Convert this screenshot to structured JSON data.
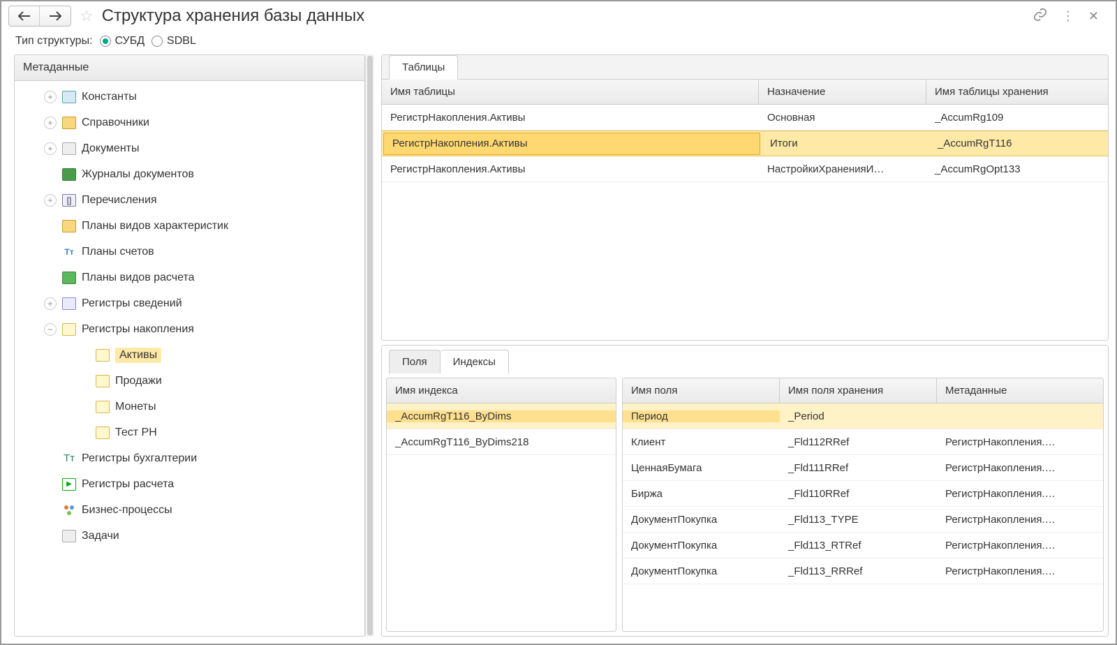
{
  "titlebar": {
    "title": "Структура хранения базы данных"
  },
  "structure_type": {
    "label": "Тип структуры:",
    "opt1": "СУБД",
    "opt2": "SDBL"
  },
  "tree": {
    "header": "Метаданные",
    "items": [
      {
        "label": "Константы",
        "icon": "const",
        "exp": "plus",
        "lvl": 0
      },
      {
        "label": "Справочники",
        "icon": "catalog",
        "exp": "plus",
        "lvl": 0
      },
      {
        "label": "Документы",
        "icon": "doc",
        "exp": "plus",
        "lvl": 0
      },
      {
        "label": "Журналы документов",
        "icon": "journal",
        "exp": "",
        "lvl": 0
      },
      {
        "label": "Перечисления",
        "icon": "enum",
        "exp": "plus",
        "lvl": 0
      },
      {
        "label": "Планы видов характеристик",
        "icon": "plan",
        "exp": "",
        "lvl": 0
      },
      {
        "label": "Планы счетов",
        "icon": "acct",
        "exp": "",
        "lvl": 0
      },
      {
        "label": "Планы видов расчета",
        "icon": "calc",
        "exp": "",
        "lvl": 0
      },
      {
        "label": "Регистры сведений",
        "icon": "inforeg",
        "exp": "plus",
        "lvl": 0
      },
      {
        "label": "Регистры накопления",
        "icon": "accreg",
        "exp": "minus",
        "lvl": 0
      },
      {
        "label": "Активы",
        "icon": "accreg",
        "exp": "",
        "lvl": 1,
        "sel": true
      },
      {
        "label": "Продажи",
        "icon": "accreg",
        "exp": "",
        "lvl": 1
      },
      {
        "label": "Монеты",
        "icon": "accreg",
        "exp": "",
        "lvl": 1
      },
      {
        "label": "Тест РН",
        "icon": "accreg",
        "exp": "",
        "lvl": 1
      },
      {
        "label": "Регистры бухгалтерии",
        "icon": "bookreg",
        "exp": "",
        "lvl": 0
      },
      {
        "label": "Регистры расчета",
        "icon": "calcreg",
        "exp": "",
        "lvl": 0
      },
      {
        "label": "Бизнес-процессы",
        "icon": "bp",
        "exp": "",
        "lvl": 0
      },
      {
        "label": "Задачи",
        "icon": "task",
        "exp": "",
        "lvl": 0
      }
    ]
  },
  "tables": {
    "tab": "Таблицы",
    "col1": "Имя таблицы",
    "col2": "Назначение",
    "col3": "Имя таблицы хранения",
    "rows": [
      {
        "c1": "РегистрНакопления.Активы",
        "c2": "Основная",
        "c3": "_AccumRg109"
      },
      {
        "c1": "РегистрНакопления.Активы",
        "c2": "Итоги",
        "c3": "_AccumRgT116",
        "sel": true
      },
      {
        "c1": "РегистрНакопления.Активы",
        "c2": "НастройкиХраненияИ…",
        "c3": "_AccumRgOpt133"
      }
    ]
  },
  "lower": {
    "tab_fields": "Поля",
    "tab_indexes": "Индексы",
    "idx_col": "Имя индекса",
    "idx_rows": [
      {
        "c1": "_AccumRgT116_ByDims",
        "sel": true
      },
      {
        "c1": "_AccumRgT116_ByDims218"
      }
    ],
    "fld_col1": "Имя поля",
    "fld_col2": "Имя поля хранения",
    "fld_col3": "Метаданные",
    "fld_rows": [
      {
        "c1": "Период",
        "c2": "_Period",
        "c3": "",
        "sel": true
      },
      {
        "c1": "Клиент",
        "c2": "_Fld112RRef",
        "c3": "РегистрНакопления.…"
      },
      {
        "c1": "ЦеннаяБумага",
        "c2": "_Fld111RRef",
        "c3": "РегистрНакопления.…"
      },
      {
        "c1": "Биржа",
        "c2": "_Fld110RRef",
        "c3": "РегистрНакопления.…"
      },
      {
        "c1": "ДокументПокупка",
        "c2": "_Fld113_TYPE",
        "c3": "РегистрНакопления.…"
      },
      {
        "c1": "ДокументПокупка",
        "c2": "_Fld113_RTRef",
        "c3": "РегистрНакопления.…"
      },
      {
        "c1": "ДокументПокупка",
        "c2": "_Fld113_RRRef",
        "c3": "РегистрНакопления.…"
      }
    ]
  }
}
